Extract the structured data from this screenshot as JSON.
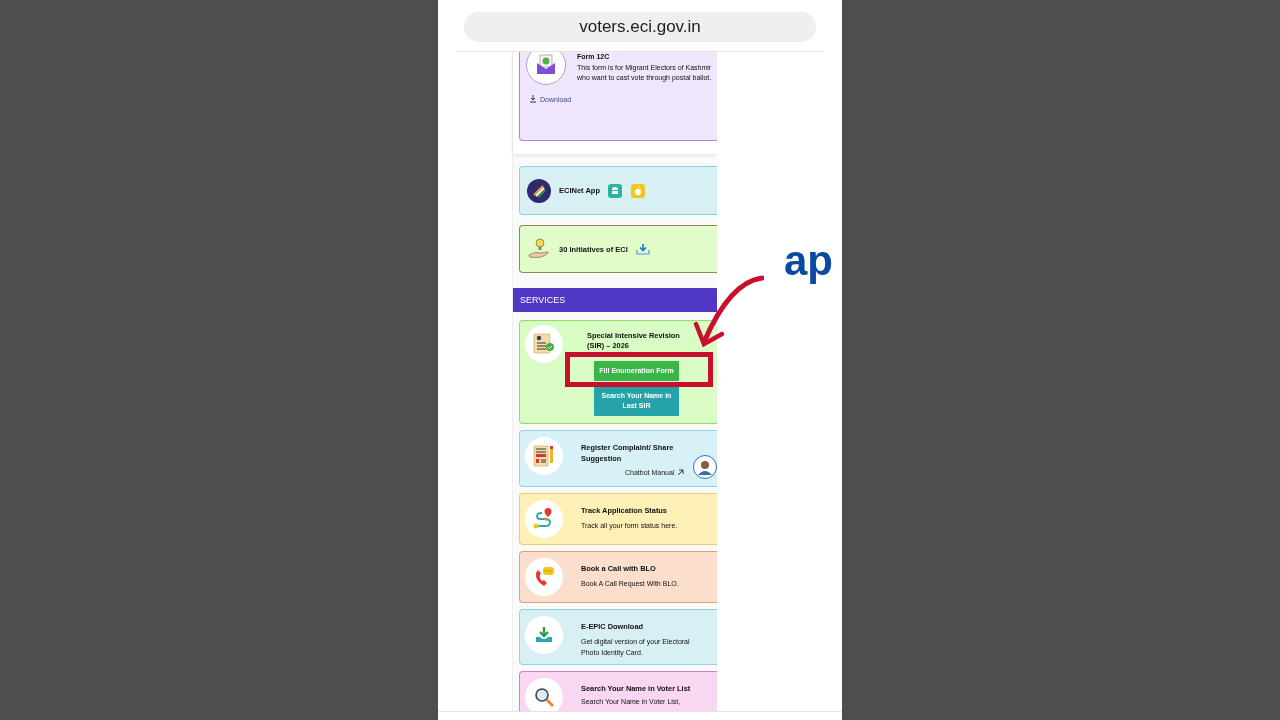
{
  "browser": {
    "url": "voters.eci.gov.in"
  },
  "form_card": {
    "title": "Form 12C",
    "description": "This form is for Migrant Electors of Kashmir who want to cast vote through postal ballot.",
    "link": "Download"
  },
  "app_cards": [
    {
      "kind": "app",
      "label": "ECINet App"
    },
    {
      "kind": "initiatives",
      "label": "30 Initiatives of ECI"
    }
  ],
  "services": {
    "header": "SERVICES",
    "items": [
      {
        "kind": "sir",
        "title": "Special Intensive Revision (SIR) – 2026",
        "buttons": [
          {
            "kind": "primary",
            "label": "Fill Enumeration Form"
          },
          {
            "kind": "secondary",
            "label": "Search Your Name in Last SIR"
          }
        ]
      },
      {
        "kind": "complaint",
        "title": "Register Complaint/ Share Suggestion",
        "link": "Chatbot Manual"
      },
      {
        "kind": "track",
        "title": "Track Application Status",
        "description": "Track all your form status here."
      },
      {
        "kind": "blo",
        "title": "Book a Call with BLO",
        "description": "Book A Call Request With BLO."
      },
      {
        "kind": "epic",
        "title": "E-EPIC Download",
        "description": "Get digital version of your Electoral Photo Identity Card."
      },
      {
        "kind": "search",
        "title": "Search Your Name in Voter List",
        "description": "Search Your Name in Voter List,"
      }
    ]
  },
  "annotation": {
    "label": "ap"
  }
}
